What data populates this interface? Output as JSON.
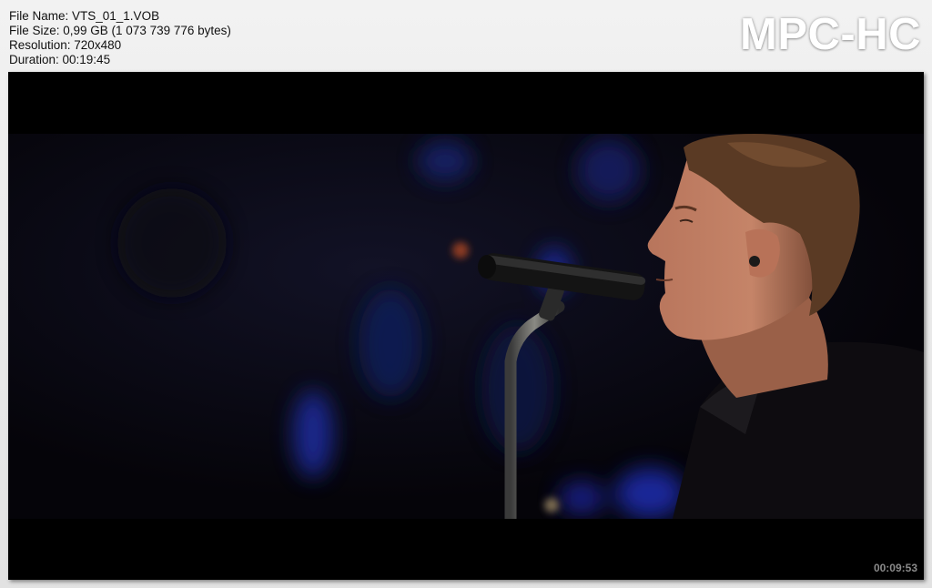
{
  "info": {
    "file_name": "File Name: VTS_01_1.VOB",
    "file_size": "File Size: 0,99 GB (1 073 739 776 bytes)",
    "resolution": "Resolution: 720x480",
    "duration": "Duration: 00:19:45"
  },
  "logo": "MPC-HC",
  "frame": {
    "timestamp": "00:09:53"
  },
  "colors": {
    "background": "#ececec",
    "frame": "#000000",
    "stage_light": "#2030a0",
    "skin": "#c58468",
    "hair": "#5a3a24"
  }
}
